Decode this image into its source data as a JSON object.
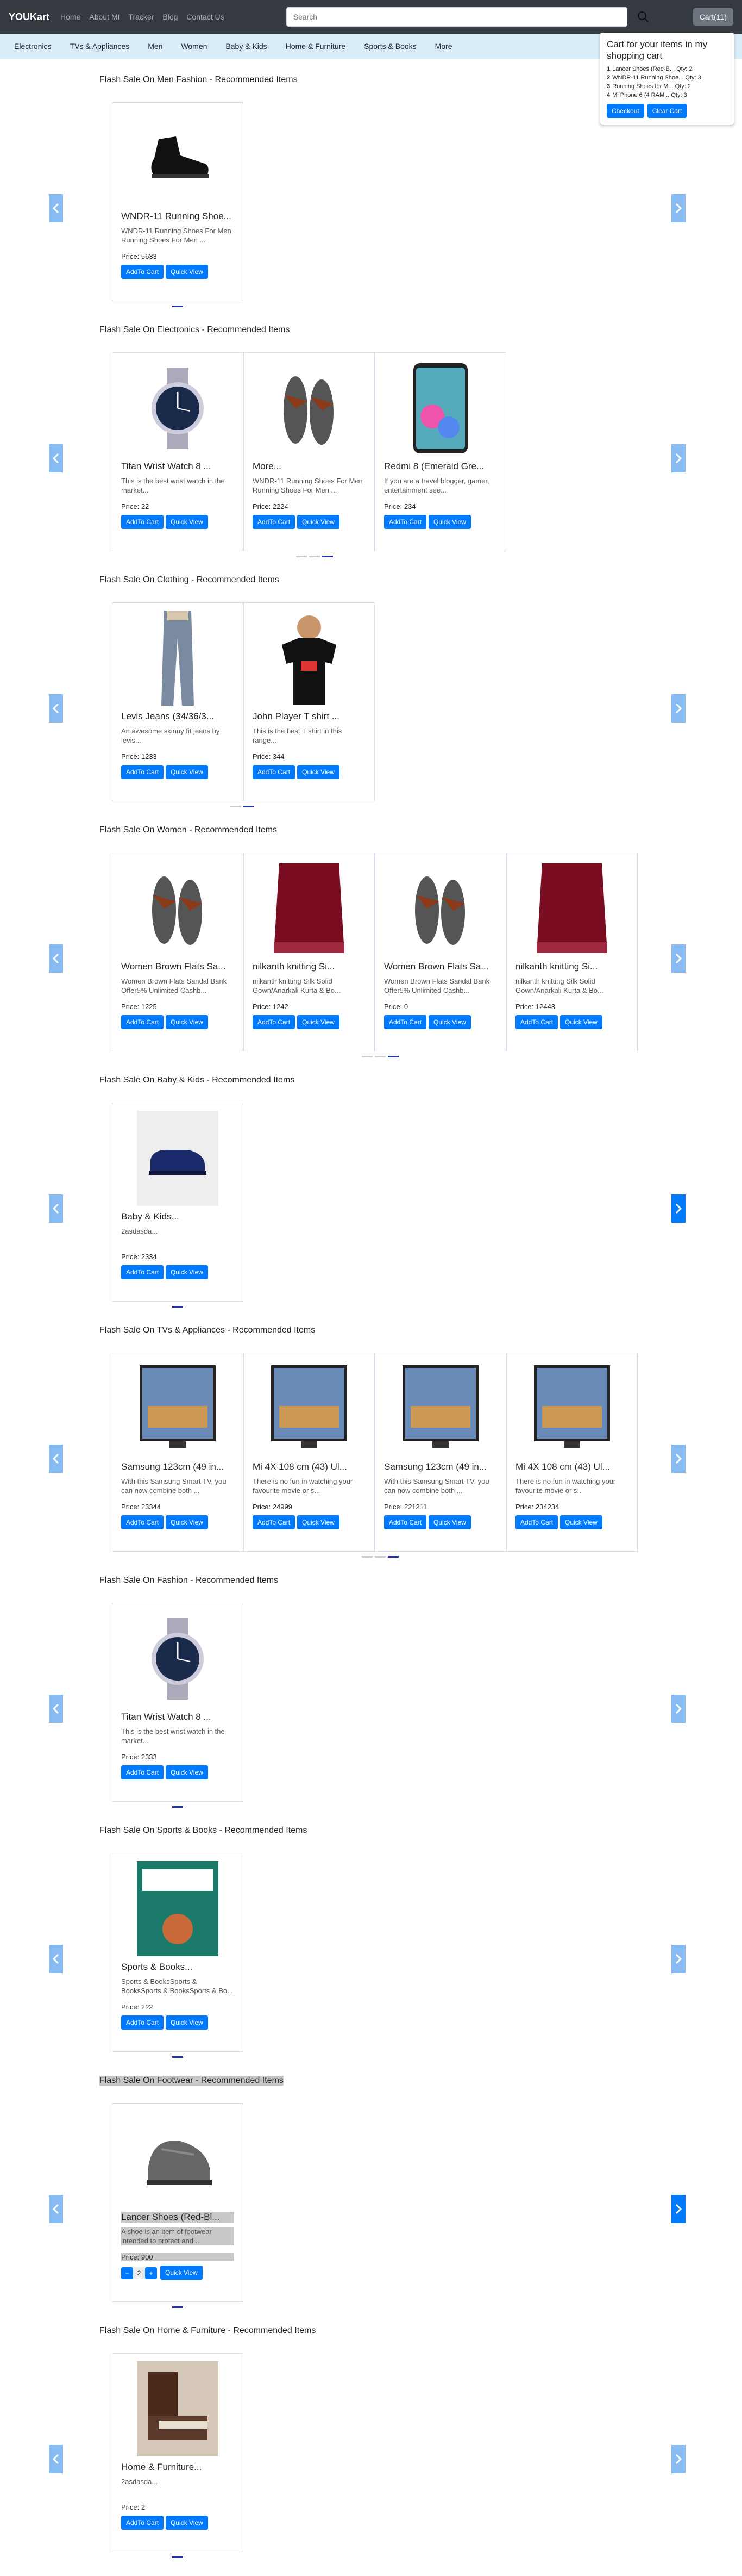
{
  "nav": {
    "brand": "YOUKart",
    "links": [
      "Home",
      "About MI",
      "Tracker",
      "Blog",
      "Contact Us"
    ],
    "search_placeholder": "Search",
    "cart_label": "Cart(11)"
  },
  "categories": [
    "Electronics",
    "TVs & Appliances",
    "Men",
    "Women",
    "Baby & Kids",
    "Home & Furniture",
    "Sports & Books",
    "More"
  ],
  "cart_popover": {
    "title": "Cart for your items in my shopping cart",
    "items": [
      {
        "n": "1",
        "text": "Lancer Shoes (Red-B... Qty: 2"
      },
      {
        "n": "2",
        "text": "WNDR-11 Running Shoe... Qty: 3"
      },
      {
        "n": "3",
        "text": "Running Shoes for M... Qty: 2"
      },
      {
        "n": "4",
        "text": "Mi Phone 6 (4 RAM... Qty: 3"
      }
    ],
    "checkout": "Checkout",
    "clear": "Clear Cart"
  },
  "labels": {
    "add": "AddTo Cart",
    "view": "Quick View"
  },
  "sections": [
    {
      "title": "Flash Sale On Men Fashion - Recommended Items",
      "dark_right": false,
      "highlight": false,
      "products": [
        {
          "name": "WNDR-11 Running Shoe...",
          "desc": "WNDR-11 Running Shoes For Men Running Shoes For Men ...",
          "price": "Price: 5633",
          "icon": "shoe-icon"
        }
      ]
    },
    {
      "title": "Flash Sale On Electronics - Recommended Items",
      "dark_right": false,
      "highlight": false,
      "products": [
        {
          "name": "Titan Wrist Watch 8 ...",
          "desc": "This is the best wrist watch in the market...",
          "price": "Price: 22",
          "icon": "watch-icon"
        },
        {
          "name": "More...",
          "desc": "WNDR-11 Running Shoes For Men Running Shoes For Men ...",
          "price": "Price: 2224",
          "icon": "sandal-icon"
        },
        {
          "name": "Redmi 8 (Emerald Gre...",
          "desc": "If you are a travel blogger, gamer, entertainment see...",
          "price": "Price: 234",
          "icon": "phone-icon"
        }
      ]
    },
    {
      "title": "Flash Sale On Clothing - Recommended Items",
      "dark_right": false,
      "highlight": false,
      "products": [
        {
          "name": "Levis Jeans (34/36/3...",
          "desc": "An awesome skinny fit jeans by levis...",
          "price": "Price: 1233",
          "icon": "jeans-icon"
        },
        {
          "name": "John Player T shirt ...",
          "desc": "This is the best T shirt in this range...",
          "price": "Price: 344",
          "icon": "tshirt-icon"
        }
      ]
    },
    {
      "title": "Flash Sale On Women - Recommended Items",
      "dark_right": false,
      "highlight": false,
      "products": [
        {
          "name": "Women Brown Flats Sa...",
          "desc": "Women Brown Flats Sandal Bank Offer5% Unlimited Cashb...",
          "price": "Price: 1225",
          "icon": "sandal-icon"
        },
        {
          "name": "nilkanth knitting Si...",
          "desc": "nilkanth knitting Silk Solid Gown/Anarkali Kurta & Bo...",
          "price": "Price: 1242",
          "icon": "fabric-icon"
        },
        {
          "name": "Women Brown Flats Sa...",
          "desc": "Women Brown Flats Sandal Bank Offer5% Unlimited Cashb...",
          "price": "Price: 0",
          "icon": "sandal-icon"
        },
        {
          "name": "nilkanth knitting Si...",
          "desc": "nilkanth knitting Silk Solid Gown/Anarkali Kurta & Bo...",
          "price": "Price: 12443",
          "icon": "fabric-icon"
        }
      ]
    },
    {
      "title": "Flash Sale On Baby & Kids - Recommended Items",
      "dark_right": true,
      "highlight": false,
      "products": [
        {
          "name": "Baby & Kids...",
          "desc": "2asdasda...",
          "price": "Price: 2334",
          "icon": "kids-shoe-icon"
        }
      ]
    },
    {
      "title": "Flash Sale On TVs & Appliances - Recommended Items",
      "dark_right": false,
      "highlight": false,
      "products": [
        {
          "name": "Samsung 123cm (49 in...",
          "desc": "With this Samsung Smart TV, you can now combine both ...",
          "price": "Price: 23344",
          "icon": "tv-icon"
        },
        {
          "name": "Mi 4X 108 cm (43) Ul...",
          "desc": "There is no fun in watching your favourite movie or s...",
          "price": "Price: 24999",
          "icon": "tv-icon"
        },
        {
          "name": "Samsung 123cm (49 in...",
          "desc": "With this Samsung Smart TV, you can now combine both ...",
          "price": "Price: 221211",
          "icon": "tv-icon"
        },
        {
          "name": "Mi 4X 108 cm (43) Ul...",
          "desc": "There is no fun in watching your favourite movie or s...",
          "price": "Price: 234234",
          "icon": "tv-icon"
        }
      ]
    },
    {
      "title": "Flash Sale On Fashion - Recommended Items",
      "dark_right": false,
      "highlight": false,
      "products": [
        {
          "name": "Titan Wrist Watch 8 ...",
          "desc": "This is the best wrist watch in the market...",
          "price": "Price: 2333",
          "icon": "watch-icon"
        }
      ]
    },
    {
      "title": "Flash Sale On Sports & Books - Recommended Items",
      "dark_right": false,
      "highlight": false,
      "products": [
        {
          "name": "Sports & Books...",
          "desc": "Sports & BooksSports & BooksSports & BooksSports & Bo...",
          "price": "Price: 222",
          "icon": "book-icon"
        }
      ]
    },
    {
      "title": "Flash Sale On Footwear - Recommended Items",
      "dark_right": true,
      "highlight": true,
      "products": [
        {
          "name": "Lancer Shoes (Red-Bl...",
          "desc": "A shoe is an item of footwear intended to protect and...",
          "price": "Price: 900",
          "icon": "sneaker-icon",
          "qty": "2"
        }
      ]
    },
    {
      "title": "Flash Sale On Home & Furniture - Recommended Items",
      "dark_right": false,
      "highlight": false,
      "products": [
        {
          "name": "Home & Furniture...",
          "desc": "2asdasda...",
          "price": "Price: 2",
          "icon": "bed-icon"
        }
      ]
    }
  ]
}
